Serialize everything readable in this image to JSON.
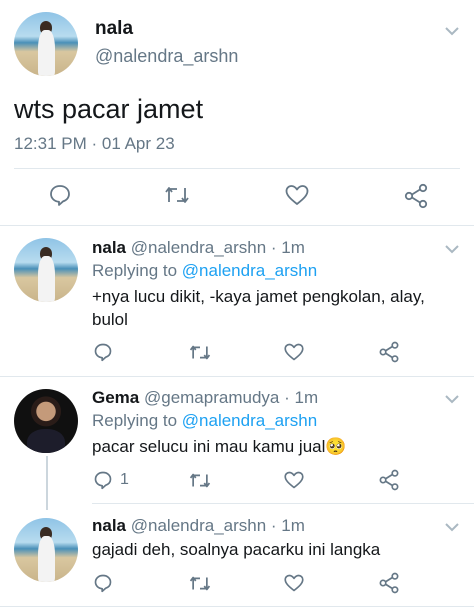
{
  "main_tweet": {
    "display_name": "nala",
    "handle": "@nalendra_arshn",
    "text": "wts pacar jamet",
    "timestamp": "12:31 PM · 01 Apr 23"
  },
  "replies": [
    {
      "display_name": "nala",
      "handle": "@nalendra_arshn",
      "time": "· 1m",
      "replying_prefix": "Replying to ",
      "replying_to": "@nalendra_arshn",
      "text": "+nya lucu dikit, -kaya jamet pengkolan, alay, bulol"
    },
    {
      "display_name": "Gema",
      "handle": "@gemapramudya",
      "time": "· 1m",
      "replying_prefix": "Replying to ",
      "replying_to": "@nalendra_arshn",
      "text": "pacar selucu ini mau kamu jual🥺",
      "reply_count": "1"
    },
    {
      "display_name": "nala",
      "handle": "@nalendra_arshn",
      "time": "· 1m",
      "text": "gajadi deh, soalnya pacarku ini langka"
    }
  ],
  "icons": {
    "reply": "reply-icon",
    "retweet": "retweet-icon",
    "like": "heart-icon",
    "share": "share-icon",
    "menu": "chevron-down-icon"
  },
  "colors": {
    "link": "#1da1f2",
    "muted": "#657786",
    "divider": "#e1e8ed",
    "text": "#14171a"
  }
}
